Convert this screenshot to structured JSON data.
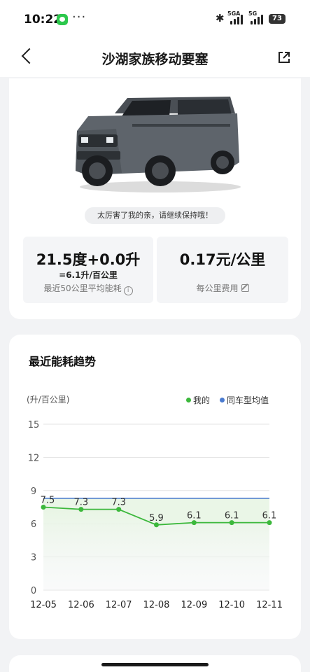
{
  "status_bar": {
    "time": "10:22",
    "dots": "···",
    "signal1_label": "5GA",
    "signal2_label": "5G",
    "battery": "73"
  },
  "header": {
    "title": "沙湖家族移动要塞"
  },
  "car_card": {
    "encouragement": "太厉害了我的亲，请继续保持哦！",
    "consumption_main": "21.5度+0.0升",
    "consumption_equiv": "=6.1升/百公里",
    "consumption_caption": "最近50公里平均能耗",
    "cost_main": "0.17元/公里",
    "cost_caption": "每公里费用"
  },
  "trend": {
    "title": "最近能耗趋势",
    "unit": "(升/百公里)",
    "legend_mine": "我的",
    "legend_avg": "同车型均值",
    "colors": {
      "mine": "#3cb83c",
      "avg": "#4a7bd0",
      "fill": "#e8f5e4"
    }
  },
  "chart_data": {
    "type": "line",
    "categories": [
      "12-05",
      "12-06",
      "12-07",
      "12-08",
      "12-09",
      "12-10",
      "12-11"
    ],
    "series": [
      {
        "name": "我的",
        "values": [
          7.5,
          7.3,
          7.3,
          5.9,
          6.1,
          6.1,
          6.1
        ]
      },
      {
        "name": "同车型均值",
        "values": [
          8.3,
          8.3,
          8.3,
          8.3,
          8.3,
          8.3,
          8.3
        ]
      }
    ],
    "yticks": [
      0,
      3,
      6,
      9,
      12,
      15
    ],
    "ylim": [
      0,
      15
    ],
    "data_labels": [
      "7.5",
      "7.3",
      "7.3",
      "5.9",
      "6.1",
      "6.1",
      "6.1"
    ]
  }
}
